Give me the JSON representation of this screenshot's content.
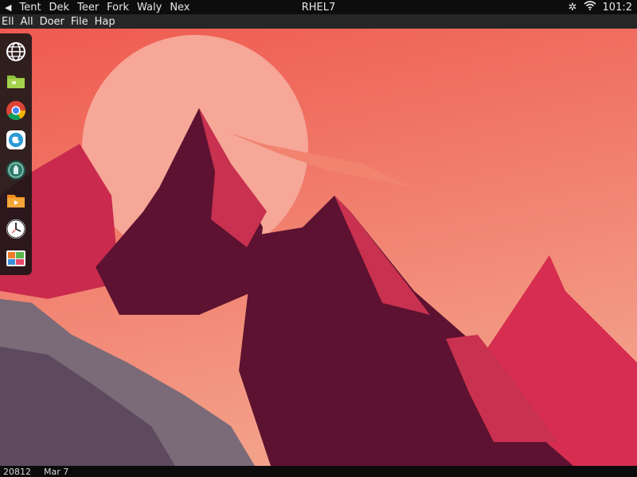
{
  "topbar": {
    "back_glyph": "◀",
    "menus": [
      "Tent",
      "Dek",
      "Teer",
      "Fork",
      "Waly",
      "Nex"
    ],
    "title": "RHEL7",
    "status": {
      "settings_glyph": "✲",
      "wifi_glyph": "Wi-Fi",
      "clock": "101:2"
    }
  },
  "menubar": {
    "items": [
      "Ell",
      "All",
      "Doer",
      "File",
      "Hap"
    ]
  },
  "dock": {
    "items": [
      {
        "name": "network-globe",
        "icon": "globe-icon"
      },
      {
        "name": "file-manager",
        "icon": "folder-icon"
      },
      {
        "name": "chrome",
        "icon": "chrome-icon"
      },
      {
        "name": "browser",
        "icon": "globe-blue-icon"
      },
      {
        "name": "settings",
        "icon": "settings-icon"
      },
      {
        "name": "archive",
        "icon": "orange-folder-icon"
      },
      {
        "name": "clock",
        "icon": "clock-icon"
      },
      {
        "name": "photos",
        "icon": "photos-icon"
      }
    ]
  },
  "bottombar": {
    "left": "20812",
    "right": "Mar 7"
  },
  "colors": {
    "sky_top": "#ef5a50",
    "sky_bottom": "#f3a089",
    "sun": "#f6a797",
    "mountain_dark": "#5c1230",
    "mountain_mid": "#c6294e",
    "rock_grey": "#7b6a78"
  }
}
